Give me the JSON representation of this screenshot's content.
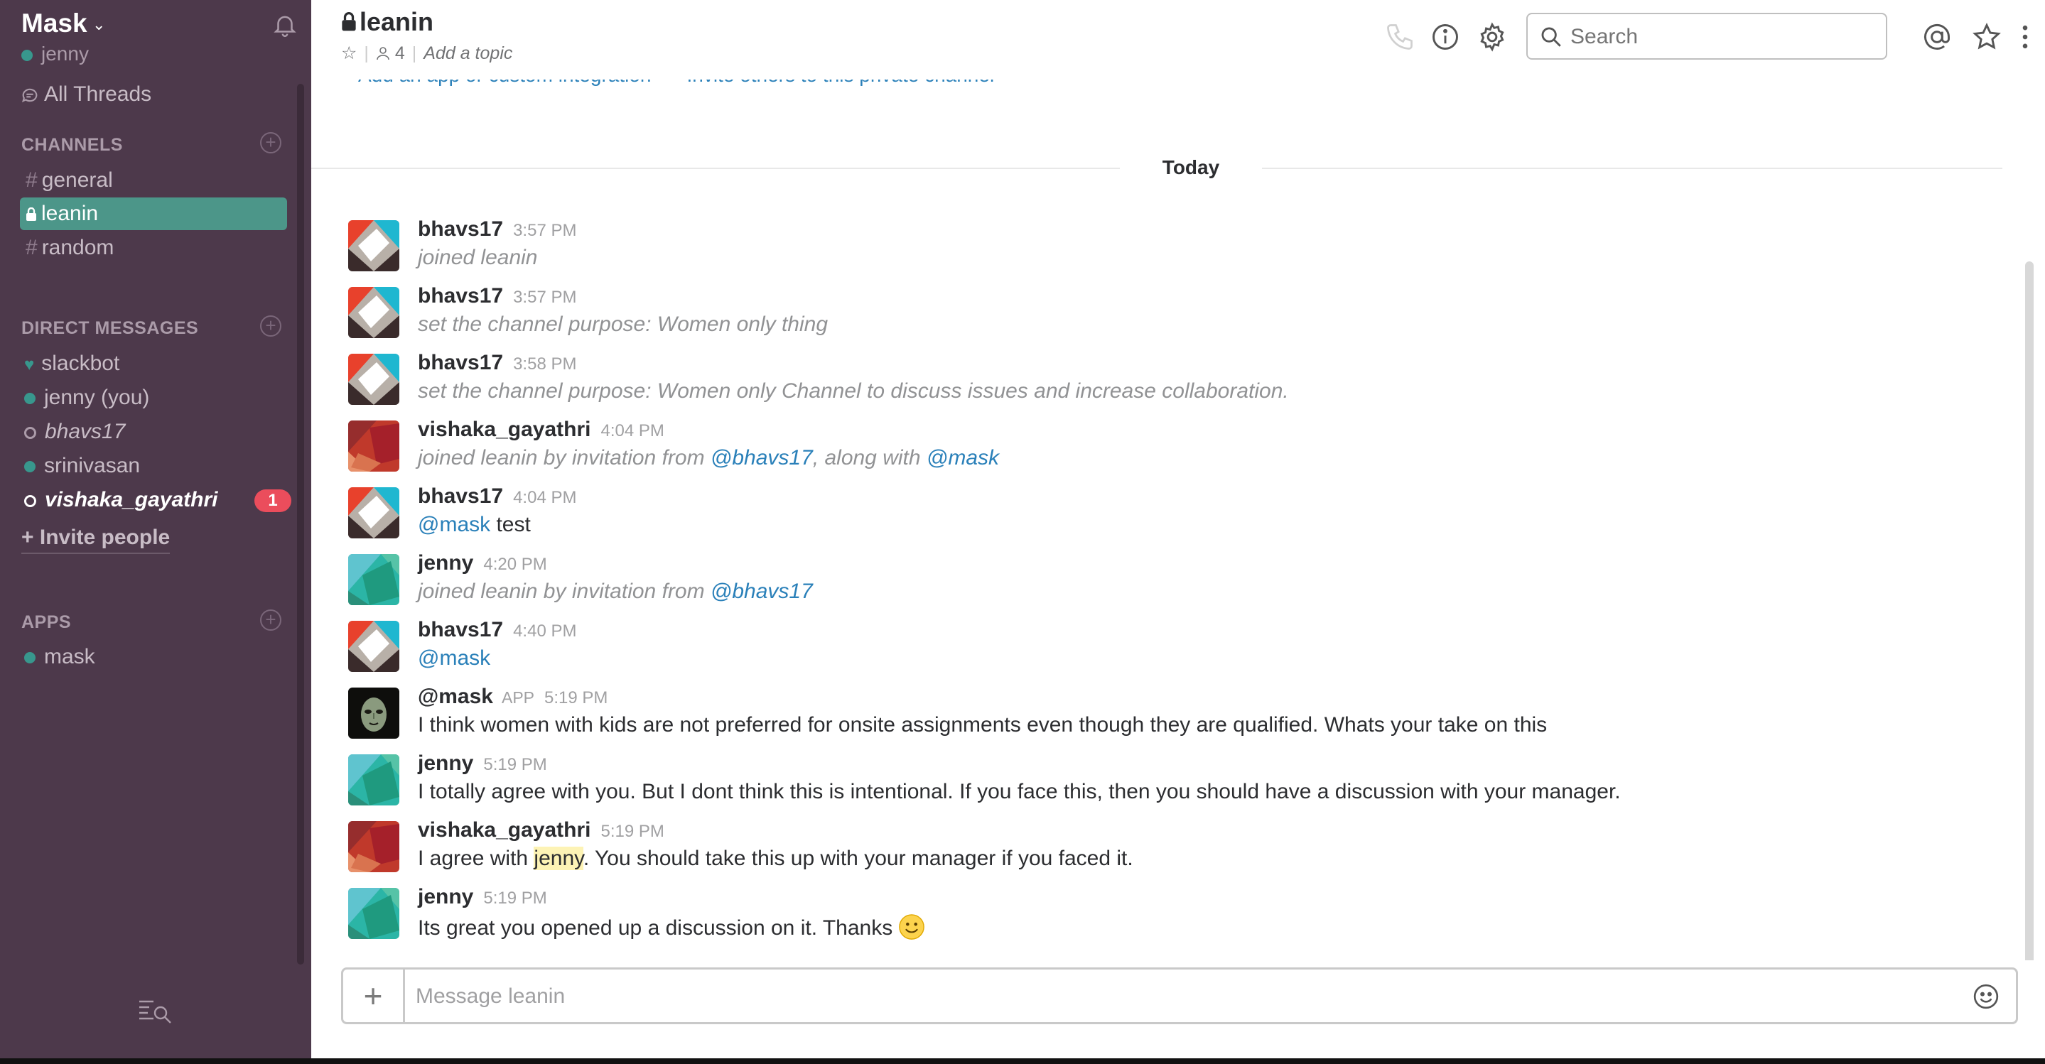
{
  "team": {
    "name": "Mask",
    "current_user": "jenny"
  },
  "sidebar": {
    "all_threads": "All Threads",
    "channels_title": "CHANNELS",
    "channels": [
      {
        "name": "general",
        "prefix": "#"
      },
      {
        "name": "leanin",
        "prefix": "lock",
        "active": true
      },
      {
        "name": "random",
        "prefix": "#"
      }
    ],
    "dm_title": "DIRECT MESSAGES",
    "dms": [
      {
        "name": "slackbot",
        "status": "heart"
      },
      {
        "name": "jenny (you)",
        "status": "online"
      },
      {
        "name": "bhavs17",
        "status": "away"
      },
      {
        "name": "srinivasan",
        "status": "online"
      },
      {
        "name": "vishaka_gayathri",
        "status": "away",
        "unread": "1"
      }
    ],
    "invite": "+ Invite people",
    "apps_title": "APPS",
    "apps": [
      {
        "name": "mask",
        "status": "online"
      }
    ]
  },
  "header": {
    "channel_name": "leanin",
    "member_count": "4",
    "topic_placeholder": "Add a topic",
    "search_placeholder": "Search"
  },
  "feed": {
    "top_links": [
      "Add an app or custom integration",
      "Invite others to this private channel"
    ],
    "day_divider": "Today",
    "messages": [
      {
        "user": "bhavs17",
        "time": "3:57 PM",
        "text": "joined leanin",
        "avatar": "red"
      },
      {
        "user": "bhavs17",
        "time": "3:57 PM",
        "text": "set the channel purpose: Women only thing",
        "avatar": "red"
      },
      {
        "user": "bhavs17",
        "time": "3:58 PM",
        "text": "set the channel purpose: Women only Channel to discuss issues and increase collaboration.",
        "avatar": "red"
      },
      {
        "user": "vishaka_gayathri",
        "time": "4:04 PM",
        "text_a": "joined leanin by invitation from ",
        "mention_a": "@bhavs17",
        "text_b": ", along with ",
        "mention_b": "@mask",
        "avatar": "maroon"
      },
      {
        "user": "bhavs17",
        "time": "4:04 PM",
        "mention": "@mask",
        "text": " test",
        "avatar": "red"
      },
      {
        "user": "jenny",
        "time": "4:20 PM",
        "text": "joined leanin by invitation from ",
        "mention": "@bhavs17",
        "avatar": "teal"
      },
      {
        "user": "bhavs17",
        "time": "4:40 PM",
        "mention": "@mask",
        "avatar": "red"
      },
      {
        "user": "@mask",
        "app_badge": "APP",
        "time": "5:19 PM",
        "text": "I think women with kids are not preferred for onsite assignments even though they are qualified. Whats your take on this",
        "avatar": "mask"
      },
      {
        "user": "jenny",
        "time": "5:19 PM",
        "text": "I totally agree with you. But I dont think this is intentional. If you face this, then you should have a discussion with your manager.",
        "avatar": "teal"
      },
      {
        "user": "vishaka_gayathri",
        "time": "5:19 PM",
        "text_a": "I agree with ",
        "highlight": "jenny",
        "text_b": ". You should take this up with your manager if you faced it.",
        "avatar": "maroon"
      },
      {
        "user": "jenny",
        "time": "5:19 PM",
        "text": "Its great you opened up a discussion on it. Thanks",
        "emoji": "slightly-smiling-face",
        "avatar": "teal"
      }
    ]
  },
  "composer": {
    "placeholder": "Message leanin"
  },
  "colors": {
    "sidebar_bg": "#4d394b",
    "active_channel": "#4c9689",
    "presence": "#38978d",
    "badge": "#eb4d5c",
    "link": "#2a80b9"
  }
}
